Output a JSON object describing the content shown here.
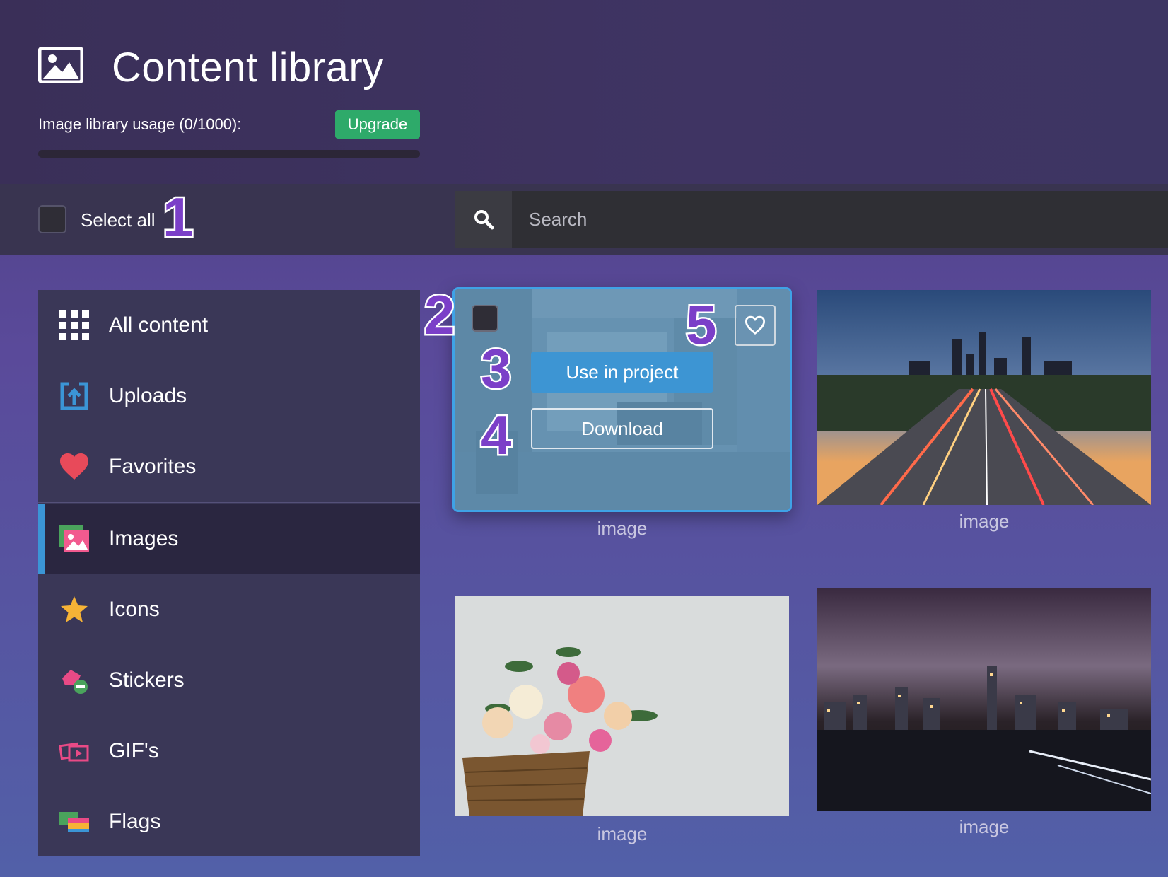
{
  "header": {
    "title": "Content library",
    "usage_label": "Image library usage (0/1000):",
    "upgrade_label": "Upgrade",
    "usage_fraction": 0
  },
  "toolbar": {
    "select_all_label": "Select all",
    "search_placeholder": "Search"
  },
  "sidebar": {
    "items": [
      {
        "label": "All content",
        "icon": "grid-icon"
      },
      {
        "label": "Uploads",
        "icon": "upload-icon"
      },
      {
        "label": "Favorites",
        "icon": "heart-icon"
      },
      {
        "label": "Images",
        "icon": "image-icon",
        "active": true
      },
      {
        "label": "Icons",
        "icon": "star-icon"
      },
      {
        "label": "Stickers",
        "icon": "sticker-icon"
      },
      {
        "label": "GIF's",
        "icon": "gif-icon"
      },
      {
        "label": "Flags",
        "icon": "flag-icon"
      }
    ]
  },
  "cards": [
    {
      "label": "image",
      "use_label": "Use in project",
      "download_label": "Download"
    },
    {
      "label": "image"
    },
    {
      "label": "image"
    },
    {
      "label": "image"
    }
  ],
  "annotations": [
    "1",
    "2",
    "3",
    "4",
    "5"
  ],
  "colors": {
    "accent": "#3b95d6",
    "upgrade": "#2eaa6a",
    "badge": "#7b3fc8"
  }
}
